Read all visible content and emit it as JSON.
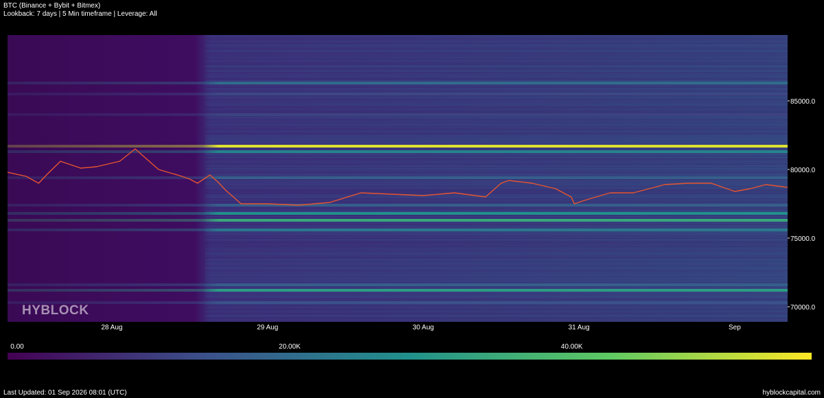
{
  "header": {
    "title": "BTC (Binance + Bybit + Bitmex)",
    "subtitle": "Lookback: 7 days | 5 Min timeframe | Leverage: All"
  },
  "watermark": "HYBLOCK",
  "footer": {
    "updated": "Last Updated: 01 Sep 2026 08:01 (UTC)",
    "site": "hyblockcapital.com"
  },
  "colors": {
    "background": "#000000",
    "price_line": "#e8552e",
    "colormap": [
      "#440154",
      "#3b528b",
      "#21918c",
      "#5ec962",
      "#fde725"
    ]
  },
  "chart_data": {
    "type": "heatmap",
    "title": "BTC (Binance + Bybit + Bitmex)",
    "x_tick_labels": [
      "28 Aug",
      "29 Aug",
      "30 Aug",
      "31 Aug",
      "Sep"
    ],
    "x_days": [
      0,
      1,
      2,
      3,
      4
    ],
    "xlim_days": [
      -0.67,
      4.34
    ],
    "ylim": [
      68900,
      89800
    ],
    "y_ticks": [
      70000,
      75000,
      80000,
      85000
    ],
    "y_tick_labels": [
      "70000.0",
      "75000.0",
      "80000.0",
      "85000.0"
    ],
    "colorbar": {
      "range": [
        0,
        57000
      ],
      "ticks": [
        0,
        20000,
        40000
      ],
      "tick_labels": [
        "0.00",
        "20.00K",
        "40.00K"
      ]
    },
    "liquidation_bands": [
      {
        "price": 86300,
        "intensity": 0.35
      },
      {
        "price": 85500,
        "intensity": 0.22
      },
      {
        "price": 84000,
        "intensity": 0.2
      },
      {
        "price": 81700,
        "intensity": 0.95
      },
      {
        "price": 81300,
        "intensity": 0.45
      },
      {
        "price": 79400,
        "intensity": 0.3
      },
      {
        "price": 77400,
        "intensity": 0.3
      },
      {
        "price": 76800,
        "intensity": 0.5
      },
      {
        "price": 76300,
        "intensity": 0.6
      },
      {
        "price": 75600,
        "intensity": 0.4
      },
      {
        "price": 71600,
        "intensity": 0.3
      },
      {
        "price": 71200,
        "intensity": 0.55
      },
      {
        "price": 70300,
        "intensity": 0.25
      }
    ],
    "price_series": {
      "name": "",
      "x_days": [
        -0.67,
        -0.55,
        -0.47,
        -0.42,
        -0.33,
        -0.2,
        -0.1,
        0.05,
        0.15,
        0.3,
        0.45,
        0.5,
        0.55,
        0.63,
        0.68,
        0.73,
        0.83,
        1.0,
        1.2,
        1.4,
        1.6,
        1.8,
        2.0,
        2.2,
        2.4,
        2.5,
        2.55,
        2.7,
        2.85,
        2.95,
        2.97,
        3.05,
        3.2,
        3.35,
        3.45,
        3.55,
        3.7,
        3.85,
        4.0,
        4.1,
        4.2,
        4.34
      ],
      "values": [
        79800,
        79500,
        79000,
        79600,
        80600,
        80100,
        80200,
        80600,
        81500,
        80000,
        79500,
        79300,
        79000,
        79600,
        79100,
        78500,
        77500,
        77500,
        77400,
        77600,
        78300,
        78200,
        78100,
        78300,
        78000,
        79000,
        79200,
        79000,
        78600,
        78000,
        77500,
        77800,
        78300,
        78300,
        78600,
        78900,
        79000,
        79000,
        78400,
        78600,
        78900,
        78700
      ]
    }
  }
}
